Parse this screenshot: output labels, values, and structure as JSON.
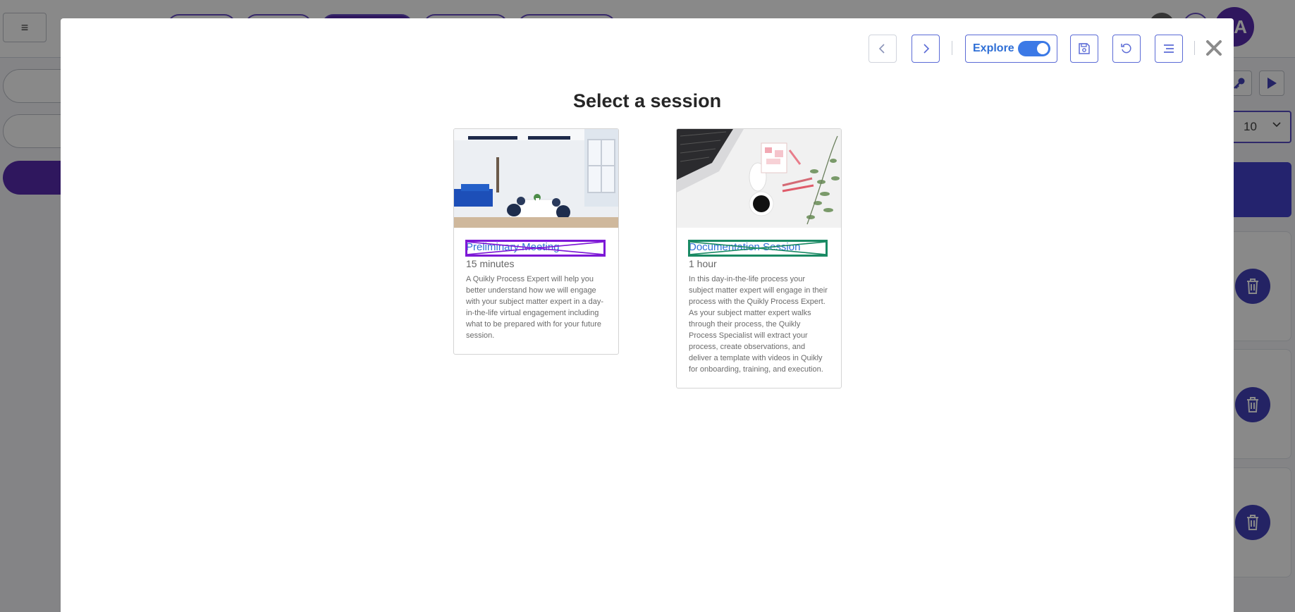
{
  "background": {
    "menu_glyph": "≡",
    "select_value": "10"
  },
  "toolbar": {
    "prev_icon": "chevron-left",
    "next_icon": "chevron-right",
    "explore_label": "Explore",
    "explore_on": true,
    "save_icon": "save",
    "refresh_icon": "refresh",
    "list_icon": "list"
  },
  "modal": {
    "title": "Select a session"
  },
  "sessions": [
    {
      "title": "Preliminary Meeting",
      "duration": "15 minutes",
      "description": "A Quikly Process Expert will help you better understand how we will engage with your subject matter expert in a day-in-the-life virtual engagement including what to be prepared with for your future session.",
      "highlight_color": "#7d18d6"
    },
    {
      "title": "Documentation Session",
      "duration": "1 hour",
      "description": "In this day-in-the-life process your subject matter expert will engage in their process with the Quikly Process Expert. As your subject matter expert walks through their process, the Quikly Process Specialist will extract your process, create observations, and deliver a template with videos in Quikly for onboarding, training, and execution.",
      "highlight_color": "#1a8a64"
    }
  ],
  "colors": {
    "link": "#2f6fd6",
    "accent": "#4a1aa8"
  }
}
